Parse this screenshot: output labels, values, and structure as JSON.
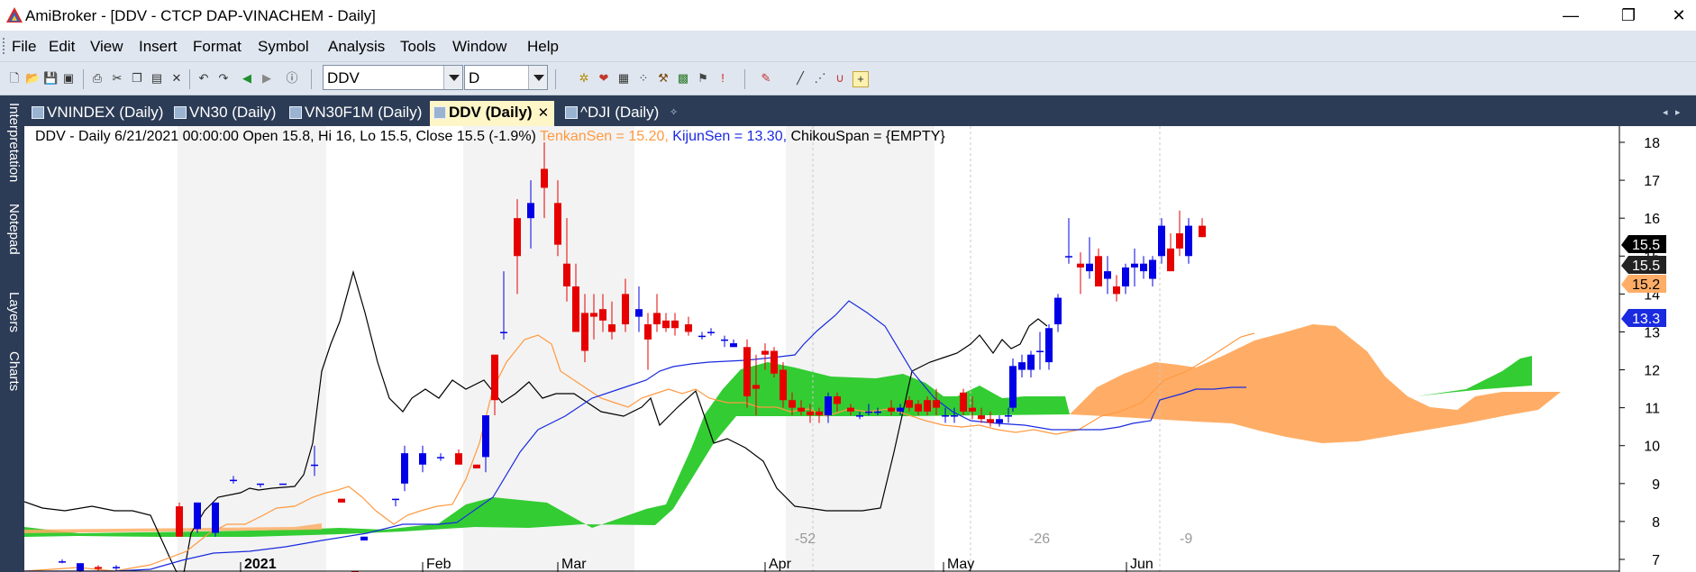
{
  "window": {
    "title": "AmiBroker - [DDV - CTCP DAP-VINACHEM - Daily]",
    "minimize": "—",
    "restore": "❐",
    "close": "✕"
  },
  "menu": [
    "File",
    "Edit",
    "View",
    "Insert",
    "Format",
    "Symbol",
    "Analysis",
    "Tools",
    "Window",
    "Help"
  ],
  "toolbar": {
    "symbol_value": "DDV",
    "interval_value": "D"
  },
  "sidebar_tabs": [
    "Interpretation",
    "Notepad",
    "Layers",
    "Charts"
  ],
  "tabs": [
    {
      "label": "VNINDEX (Daily)",
      "active": false
    },
    {
      "label": "VN30 (Daily)",
      "active": false
    },
    {
      "label": "VN30F1M (Daily)",
      "active": false
    },
    {
      "label": "DDV (Daily)",
      "active": true
    },
    {
      "label": "^DJI (Daily)",
      "active": false
    }
  ],
  "chart_header": {
    "prefix": "DDV - Daily 6/21/2021 00:00:00 Open 15.8, Hi 16, Lo 15.5, Close 15.5 (-1.9%)",
    "tenkan": "TenkanSen = 15.20,",
    "kijun": "KijunSen = 13.30,",
    "chikou": "ChikouSpan = {EMPTY}"
  },
  "colors": {
    "bull_candle": "#0000e6",
    "bear_candle": "#e60000",
    "tenkan": "#ff9a40",
    "kijun": "#1a2adf",
    "chikou": "#000000",
    "cloud_bull": "#33cc33",
    "cloud_bear": "#ffad66",
    "sidebar": "#2c3c56"
  },
  "chart_data": {
    "type": "candlestick",
    "ylim": [
      6.4,
      18.6
    ],
    "y_ticks": [
      7,
      8,
      9,
      10,
      11,
      12,
      13,
      14,
      15,
      16,
      17,
      18
    ],
    "x_labels": [
      "2021",
      "Feb",
      "Mar",
      "Apr",
      "May",
      "Jun"
    ],
    "bar_markers": [
      "-52",
      "-26",
      "-9"
    ],
    "price_labels": [
      {
        "text": "15.5",
        "value": 15.9,
        "color": "#000000"
      },
      {
        "text": "15.5",
        "value": 15.5,
        "color": "#222222"
      },
      {
        "text": "15.2",
        "value": 15.2,
        "color": "#ffad66"
      },
      {
        "text": "13.3",
        "value": 13.3,
        "color": "#1a2adf"
      }
    ],
    "legend": [
      "TenkanSen",
      "KijunSen",
      "ChikouSpan"
    ]
  }
}
